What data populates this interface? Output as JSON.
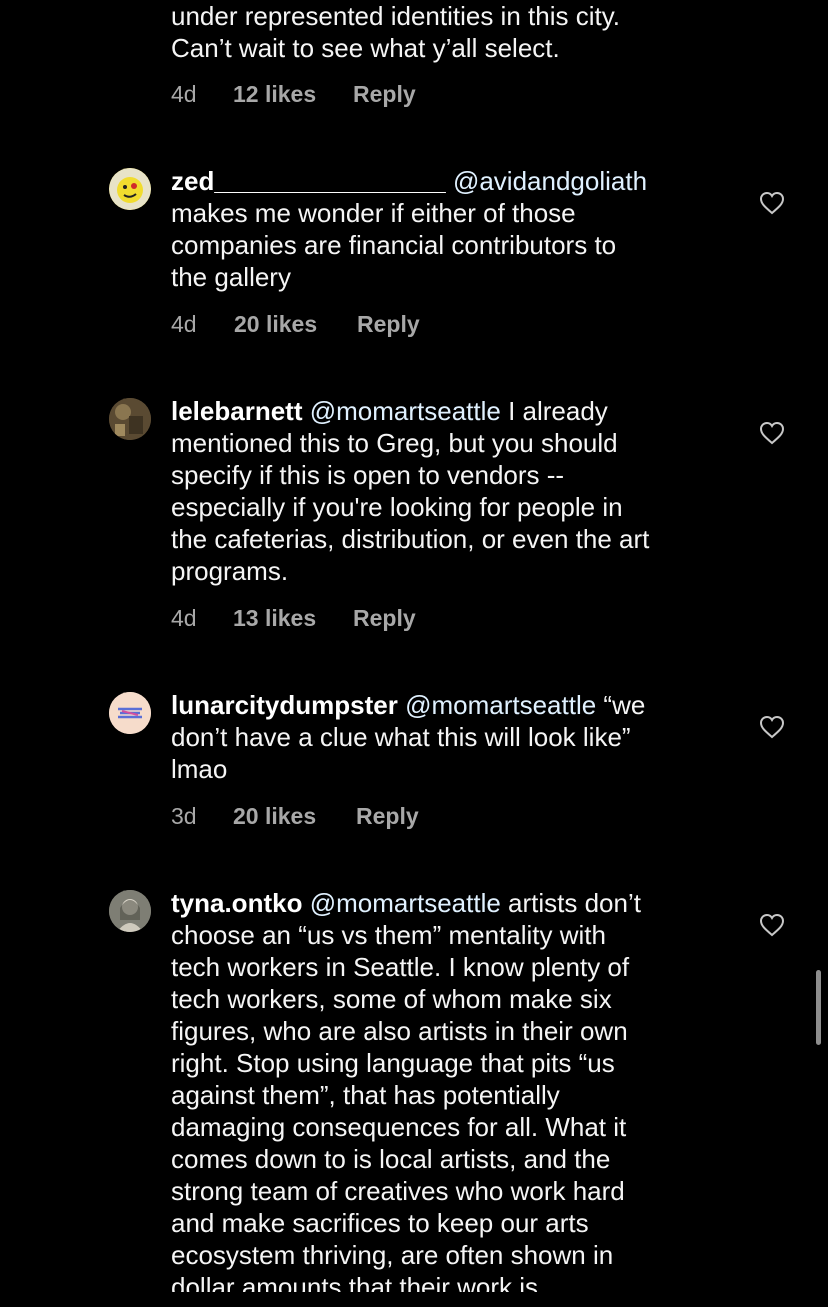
{
  "top_comment": {
    "lines": [
      "under represented identities in this city.",
      "Can’t wait to see what y’all select."
    ],
    "time": "4d",
    "likes": "12 likes",
    "reply": "Reply"
  },
  "comments": [
    {
      "username": "zed________________",
      "mention": "@avidandgoliath",
      "lines": [
        "makes me wonder if either of those",
        "companies are financial contributors to",
        "the gallery"
      ],
      "time": "4d",
      "likes": "20 likes",
      "reply": "Reply",
      "avatar_color": "#f5e24a",
      "icon": "heart-icon"
    },
    {
      "username": "lelebarnett",
      "mention": "@momartseattle",
      "first_line_tail": " I already",
      "lines": [
        "mentioned this to Greg, but you should",
        "specify if this is open to vendors --",
        "especially if you're looking for people in",
        "the cafeterias, distribution, or even the art",
        "programs."
      ],
      "time": "4d",
      "likes": "13 likes",
      "reply": "Reply",
      "avatar_color": "#6b5a3e",
      "icon": "heart-icon"
    },
    {
      "username": "lunarcitydumpster",
      "mention": "@momartseattle",
      "first_line_tail": " “we",
      "lines": [
        "don’t have a clue what this will look like”",
        "lmao"
      ],
      "time": "3d",
      "likes": "20 likes",
      "reply": "Reply",
      "avatar_color": "#f6dccb",
      "icon": "heart-icon"
    },
    {
      "username": "tyna.ontko",
      "mention": "@momartseattle",
      "first_line_tail": " artists don’t",
      "lines": [
        "choose an “us vs them” mentality with",
        "tech workers in Seattle. I know plenty of",
        "tech workers, some of whom make six",
        "figures, who are also artists in their own",
        "right. Stop using language that pits “us",
        "against them”, that has potentially",
        "damaging consequences for all. What it",
        "comes down to is local artists, and the",
        "strong team of creatives who work hard",
        "and make sacrifices to keep our arts",
        "ecosystem thriving, are often shown in",
        "dollar amounts that their work is"
      ],
      "avatar_color": "#9a9a8e",
      "icon": "heart-icon"
    }
  ]
}
